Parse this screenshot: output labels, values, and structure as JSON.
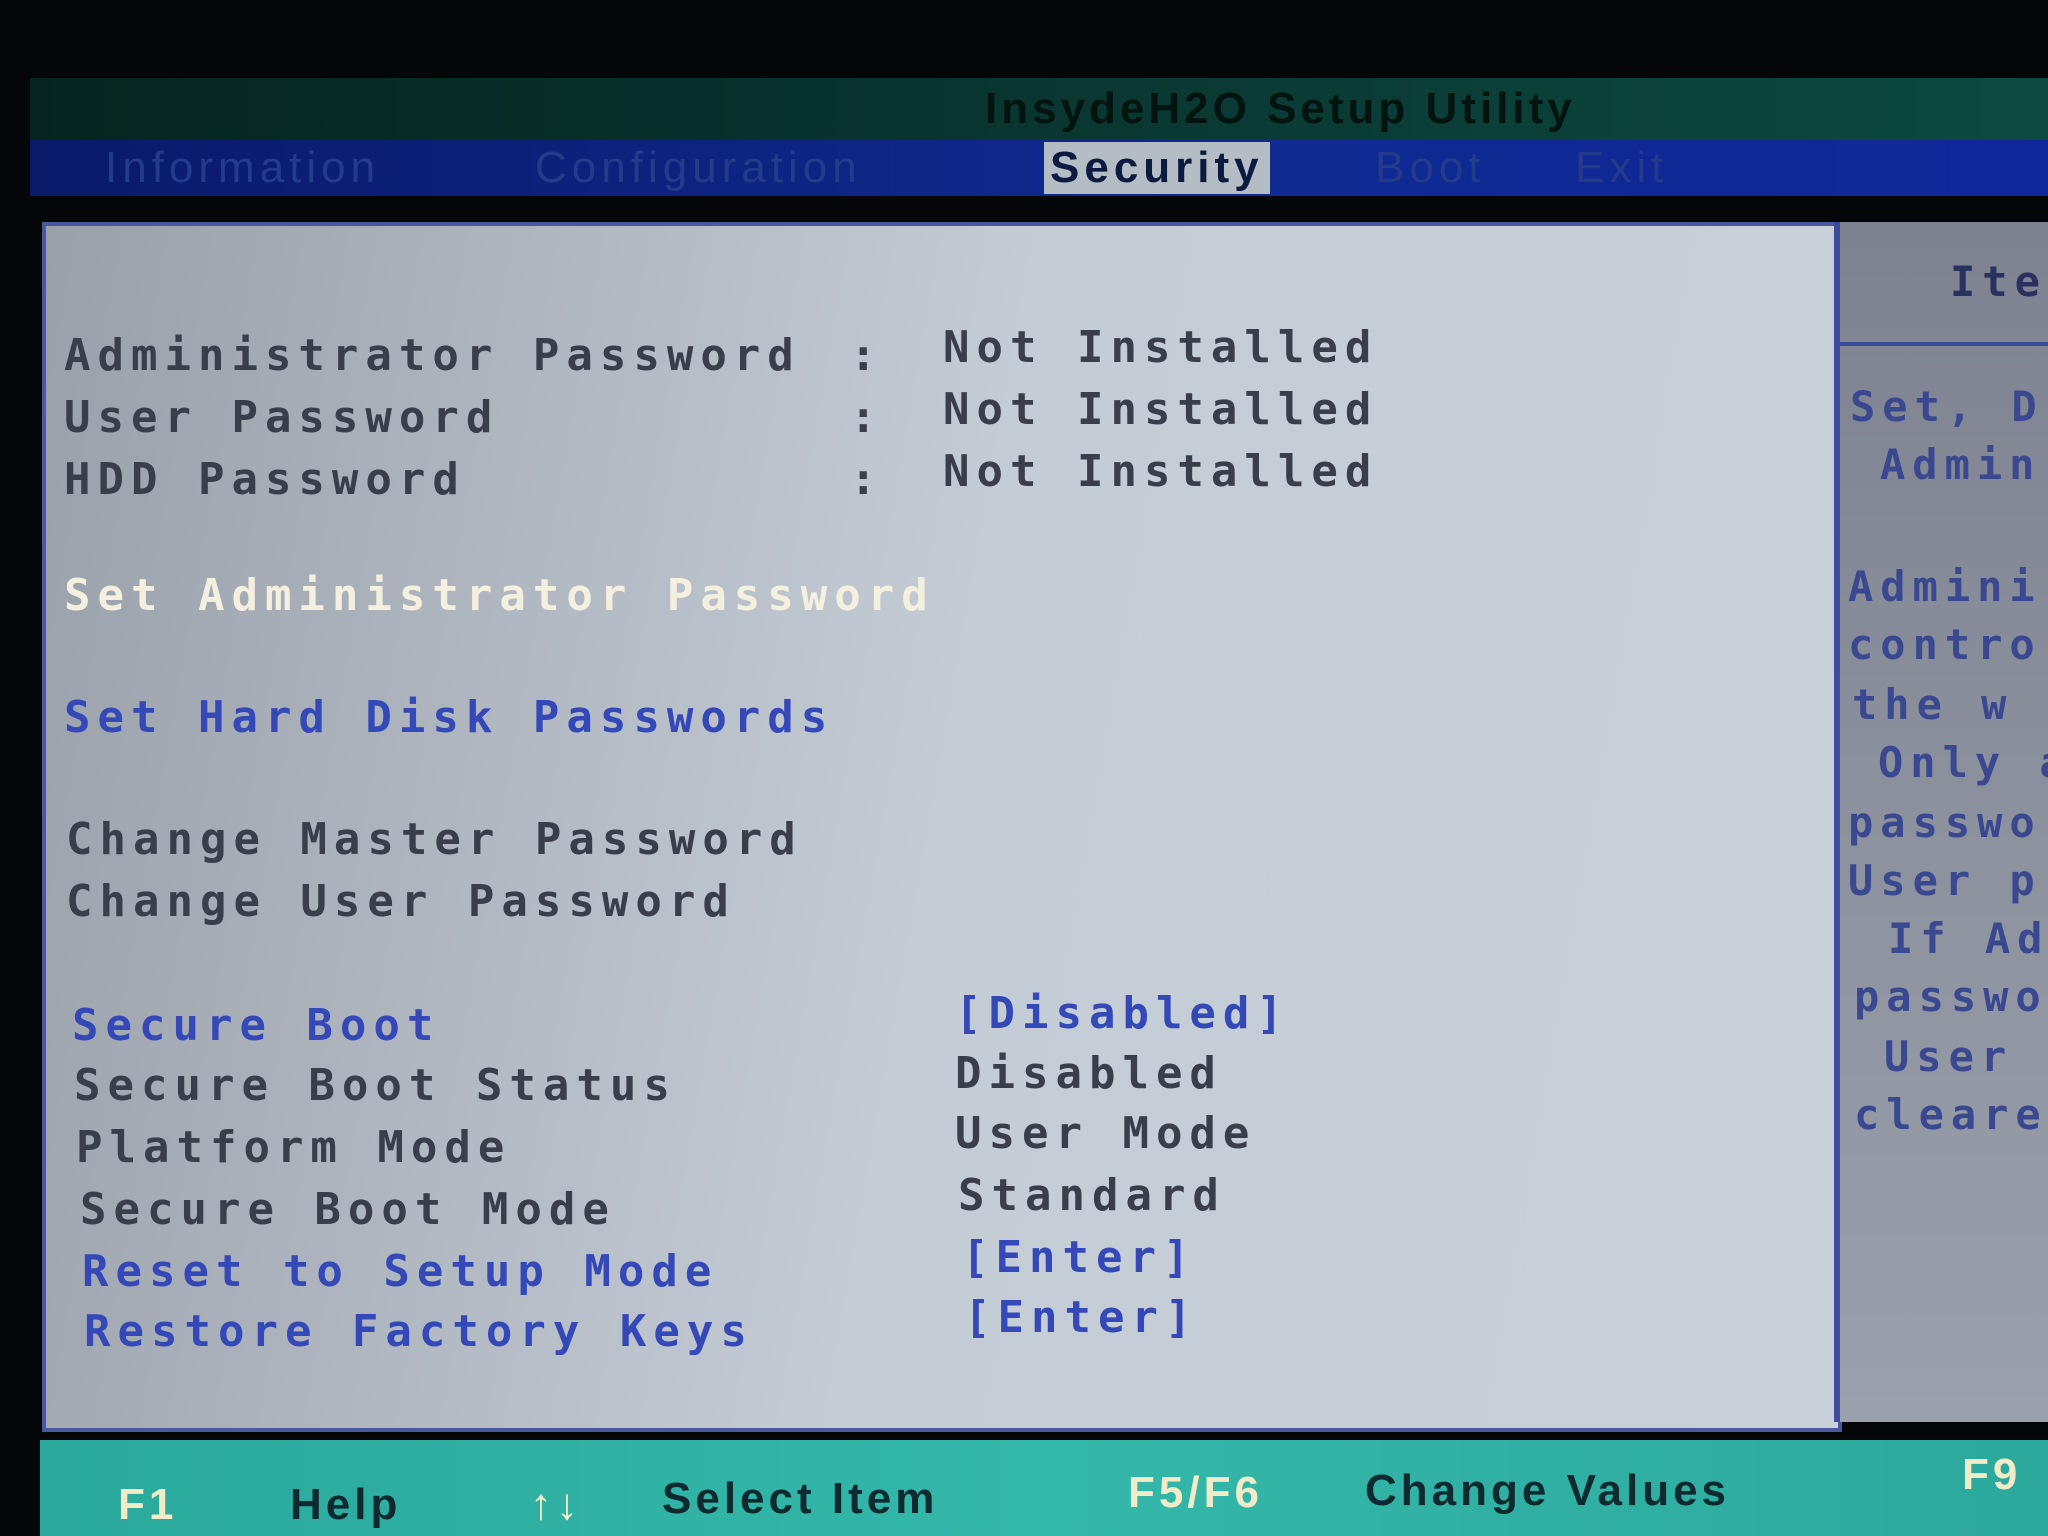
{
  "title": "InsydeH2O Setup Utility",
  "tabs": [
    {
      "label": "Information",
      "active": false
    },
    {
      "label": "Configuration",
      "active": false
    },
    {
      "label": "Security",
      "active": true
    },
    {
      "label": "Boot",
      "active": false
    },
    {
      "label": "Exit",
      "active": false
    }
  ],
  "status": [
    {
      "label": "Administrator Password",
      "sep": ":",
      "value": "Not Installed"
    },
    {
      "label": "User Password",
      "sep": ":",
      "value": "Not Installed"
    },
    {
      "label": "HDD Password",
      "sep": ":",
      "value": "Not Installed"
    }
  ],
  "items": {
    "set_admin": "Set Administrator Password",
    "set_hdd": "Set Hard Disk Passwords",
    "change_master": "Change Master Password",
    "change_user": "Change User Password"
  },
  "secure": [
    {
      "label": "Secure Boot",
      "value": "[Disabled]"
    },
    {
      "label": "Secure Boot Status",
      "value": "Disabled"
    },
    {
      "label": "Platform Mode",
      "value": "User Mode"
    },
    {
      "label": "Secure Boot Mode",
      "value": "Standard"
    },
    {
      "label": "Reset to Setup Mode",
      "value": "[Enter]"
    },
    {
      "label": "Restore Factory Keys",
      "value": "[Enter]"
    }
  ],
  "help": {
    "header": "Ite",
    "lines": [
      "Set, D",
      "Admin",
      "Admini",
      "contro",
      "the  w",
      "Only a",
      "passwo",
      "User p",
      "If Ad",
      "passwo",
      "User",
      "cleare"
    ]
  },
  "footer": [
    {
      "key": "F1",
      "desc": "Help"
    },
    {
      "key": "↑↓",
      "desc": "Select Item"
    },
    {
      "key": "F5/F6",
      "desc": "Change Values"
    },
    {
      "key": "F9",
      "desc": ""
    }
  ],
  "colors": {
    "selected": "#f4f0e0",
    "interactive": "#3448b8",
    "static": "#3a3e4a",
    "footer": "#34b8aa",
    "tabbar": "#0f2a90"
  }
}
